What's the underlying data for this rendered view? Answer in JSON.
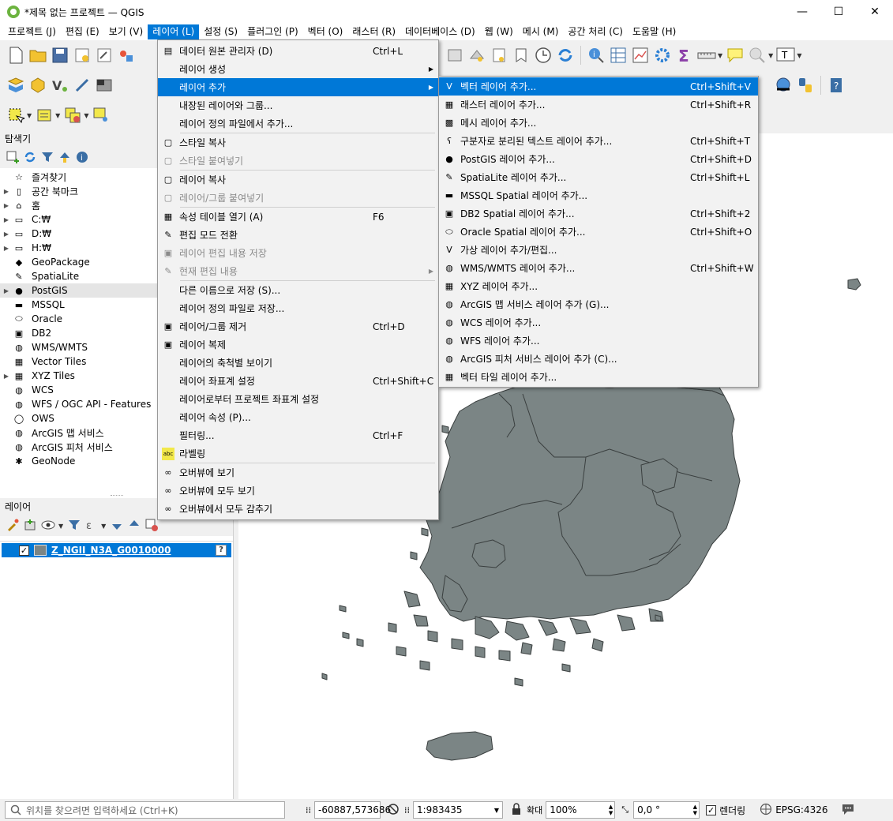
{
  "window": {
    "title": "*제목 없는 프로젝트 — QGIS",
    "minimize": "—",
    "maximize": "☐",
    "close": "✕"
  },
  "menubar": [
    {
      "label": "프로젝트 (J)",
      "active": false
    },
    {
      "label": "편집 (E)",
      "active": false
    },
    {
      "label": "보기 (V)",
      "active": false
    },
    {
      "label": "레이어 (L)",
      "active": true
    },
    {
      "label": "설정 (S)",
      "active": false
    },
    {
      "label": "플러그인 (P)",
      "active": false
    },
    {
      "label": "벡터 (O)",
      "active": false
    },
    {
      "label": "래스터 (R)",
      "active": false
    },
    {
      "label": "데이터베이스 (D)",
      "active": false
    },
    {
      "label": "웹 (W)",
      "active": false
    },
    {
      "label": "메시 (M)",
      "active": false
    },
    {
      "label": "공간 처리 (C)",
      "active": false
    },
    {
      "label": "도움말 (H)",
      "active": false
    }
  ],
  "browser_panel": {
    "title": "탐색기",
    "items": [
      {
        "label": "즐겨찾기",
        "icon": "star-icon",
        "glyph": "☆",
        "expandable": false
      },
      {
        "label": "공간 북마크",
        "icon": "bookmark-icon",
        "glyph": "▯",
        "expandable": true
      },
      {
        "label": "홈",
        "icon": "home-folder-icon",
        "glyph": "⌂",
        "expandable": true
      },
      {
        "label": "C:₩",
        "icon": "drive-icon",
        "glyph": "▭",
        "expandable": true
      },
      {
        "label": "D:₩",
        "icon": "drive-icon",
        "glyph": "▭",
        "expandable": true
      },
      {
        "label": "H:₩",
        "icon": "drive-icon",
        "glyph": "▭",
        "expandable": true
      },
      {
        "label": "GeoPackage",
        "icon": "geopackage-icon",
        "glyph": "◆",
        "expandable": false
      },
      {
        "label": "SpatiaLite",
        "icon": "spatialite-icon",
        "glyph": "✎",
        "expandable": false
      },
      {
        "label": "PostGIS",
        "icon": "postgis-elephant-icon",
        "glyph": "●",
        "expandable": true,
        "selected": true
      },
      {
        "label": "MSSQL",
        "icon": "mssql-icon",
        "glyph": "▬",
        "expandable": false
      },
      {
        "label": "Oracle",
        "icon": "oracle-icon",
        "glyph": "⬭",
        "expandable": false
      },
      {
        "label": "DB2",
        "icon": "db2-icon",
        "glyph": "▣",
        "expandable": false
      },
      {
        "label": "WMS/WMTS",
        "icon": "globe-icon",
        "glyph": "◍",
        "expandable": false
      },
      {
        "label": "Vector Tiles",
        "icon": "grid-icon",
        "glyph": "▦",
        "expandable": false
      },
      {
        "label": "XYZ Tiles",
        "icon": "grid-icon",
        "glyph": "▦",
        "expandable": true
      },
      {
        "label": "WCS",
        "icon": "globe-icon",
        "glyph": "◍",
        "expandable": false
      },
      {
        "label": "WFS / OGC API - Features",
        "icon": "globe-icon",
        "glyph": "◍",
        "expandable": false
      },
      {
        "label": "OWS",
        "icon": "ows-icon",
        "glyph": "◯",
        "expandable": false
      },
      {
        "label": "ArcGIS 맵 서비스",
        "icon": "arcgis-globe-icon",
        "glyph": "◍",
        "expandable": false
      },
      {
        "label": "ArcGIS 피처 서비스",
        "icon": "arcgis-globe-icon",
        "glyph": "◍",
        "expandable": false
      },
      {
        "label": "GeoNode",
        "icon": "geonode-icon",
        "glyph": "✱",
        "expandable": false
      }
    ]
  },
  "layers_panel": {
    "title": "레이어",
    "layer": {
      "name": "Z_NGII_N3A_G0010000",
      "checked": "✓",
      "help": "?"
    }
  },
  "layer_menu": [
    {
      "type": "item",
      "label": "데이터 원본 관리자 (D)",
      "shortcut": "Ctrl+L",
      "icon": "datasource-manager-icon",
      "glyph": "▤"
    },
    {
      "type": "item",
      "label": "레이어 생성",
      "shortcut": "",
      "arrow": true
    },
    {
      "type": "item",
      "label": "레이어 추가",
      "shortcut": "",
      "arrow": true,
      "highlight": true
    },
    {
      "type": "item",
      "label": "내장된 레이어와 그룹...",
      "shortcut": ""
    },
    {
      "type": "item",
      "label": "레이어 정의 파일에서 추가...",
      "shortcut": ""
    },
    {
      "type": "sep"
    },
    {
      "type": "item",
      "label": "스타일 복사",
      "shortcut": "",
      "icon": "copy-style-icon",
      "glyph": "▢"
    },
    {
      "type": "item",
      "label": "스타일 붙여넣기",
      "shortcut": "",
      "icon": "paste-style-icon",
      "glyph": "▢",
      "disabled": true
    },
    {
      "type": "sep"
    },
    {
      "type": "item",
      "label": "레이어 복사",
      "shortcut": "",
      "icon": "copy-layer-icon",
      "glyph": "▢"
    },
    {
      "type": "item",
      "label": "레이어/그룹 붙여넣기",
      "shortcut": "",
      "icon": "paste-layer-icon",
      "glyph": "▢",
      "disabled": true
    },
    {
      "type": "sep"
    },
    {
      "type": "item",
      "label": "속성 테이블 열기 (A)",
      "shortcut": "F6",
      "icon": "attribute-table-icon",
      "glyph": "▦"
    },
    {
      "type": "item",
      "label": "편집 모드 전환",
      "shortcut": "",
      "icon": "pencil-icon",
      "glyph": "✎"
    },
    {
      "type": "item",
      "label": "레이어 편집 내용 저장",
      "shortcut": "",
      "icon": "save-edits-icon",
      "glyph": "▣",
      "disabled": true
    },
    {
      "type": "item",
      "label": "현재 편집 내용",
      "shortcut": "",
      "icon": "current-edits-icon",
      "glyph": "✎",
      "disabled": true,
      "arrow": true
    },
    {
      "type": "sep"
    },
    {
      "type": "item",
      "label": "다른 이름으로 저장 (S)...",
      "shortcut": ""
    },
    {
      "type": "item",
      "label": "레이어 정의 파일로 저장...",
      "shortcut": ""
    },
    {
      "type": "item",
      "label": "레이어/그룹 제거",
      "shortcut": "Ctrl+D",
      "icon": "remove-layer-icon",
      "glyph": "▣"
    },
    {
      "type": "item",
      "label": "레이어 복제",
      "shortcut": "",
      "icon": "duplicate-layer-icon",
      "glyph": "▣"
    },
    {
      "type": "item",
      "label": "레이어의 축척별 보이기",
      "shortcut": ""
    },
    {
      "type": "item",
      "label": "레이어 좌표계 설정",
      "shortcut": "Ctrl+Shift+C"
    },
    {
      "type": "item",
      "label": "레이어로부터 프로젝트 좌표계 설정",
      "shortcut": ""
    },
    {
      "type": "item",
      "label": "레이어 속성 (P)...",
      "shortcut": ""
    },
    {
      "type": "item",
      "label": "필터링...",
      "shortcut": "Ctrl+F"
    },
    {
      "type": "item",
      "label": "라벨링",
      "shortcut": "",
      "icon": "labeling-icon",
      "glyph": "abc"
    },
    {
      "type": "sep"
    },
    {
      "type": "item",
      "label": "오버뷰에 보기",
      "shortcut": "",
      "icon": "overview-add-icon",
      "glyph": "∞"
    },
    {
      "type": "item",
      "label": "오버뷰에 모두 보기",
      "shortcut": "",
      "icon": "overview-all-icon",
      "glyph": "∞"
    },
    {
      "type": "item",
      "label": "오버뷰에서 모두 감추기",
      "shortcut": "",
      "icon": "overview-hide-icon",
      "glyph": "∞"
    }
  ],
  "add_layer_submenu": [
    {
      "label": "벡터 레이어 추가...",
      "shortcut": "Ctrl+Shift+V",
      "icon": "vector-layer-icon",
      "glyph": "V",
      "highlight": true
    },
    {
      "label": "래스터 레이어 추가...",
      "shortcut": "Ctrl+Shift+R",
      "icon": "raster-layer-icon",
      "glyph": "▦"
    },
    {
      "label": "메시 레이어 추가...",
      "shortcut": "",
      "icon": "mesh-layer-icon",
      "glyph": "▩"
    },
    {
      "label": "구분자로 분리된 텍스트 레이어 추가...",
      "shortcut": "Ctrl+Shift+T",
      "icon": "delimited-text-icon",
      "glyph": "ʕ"
    },
    {
      "label": "PostGIS 레이어 추가...",
      "shortcut": "Ctrl+Shift+D",
      "icon": "postgis-elephant-icon",
      "glyph": "●"
    },
    {
      "label": "SpatiaLite 레이어 추가...",
      "shortcut": "Ctrl+Shift+L",
      "icon": "spatialite-icon",
      "glyph": "✎"
    },
    {
      "label": "MSSQL Spatial 레이어 추가...",
      "shortcut": "",
      "icon": "mssql-icon",
      "glyph": "▬"
    },
    {
      "label": "DB2 Spatial 레이어 추가...",
      "shortcut": "Ctrl+Shift+2",
      "icon": "db2-icon",
      "glyph": "▣"
    },
    {
      "label": "Oracle Spatial 레이어 추가...",
      "shortcut": "Ctrl+Shift+O",
      "icon": "oracle-icon",
      "glyph": "⬭"
    },
    {
      "label": "가상 레이어 추가/편집...",
      "shortcut": "",
      "icon": "virtual-layer-icon",
      "glyph": "V"
    },
    {
      "label": "WMS/WMTS 레이어 추가...",
      "shortcut": "Ctrl+Shift+W",
      "icon": "wms-globe-icon",
      "glyph": "◍"
    },
    {
      "label": "XYZ 레이어 추가...",
      "shortcut": "",
      "icon": "xyz-grid-icon",
      "glyph": "▦"
    },
    {
      "label": "ArcGIS 맵 서비스 레이어 추가 (G)...",
      "shortcut": "",
      "icon": "arcgis-globe-icon",
      "glyph": "◍"
    },
    {
      "label": "WCS 레이어 추가...",
      "shortcut": "",
      "icon": "wcs-globe-icon",
      "glyph": "◍"
    },
    {
      "label": "WFS 레이어 추가...",
      "shortcut": "",
      "icon": "wfs-globe-icon",
      "glyph": "◍"
    },
    {
      "label": "ArcGIS 피처 서비스 레이어 추가 (C)...",
      "shortcut": "",
      "icon": "arcgis-globe-icon",
      "glyph": "◍"
    },
    {
      "label": "벡터 타일 레이어 추가...",
      "shortcut": "",
      "icon": "vector-tile-icon",
      "glyph": "▦"
    }
  ],
  "statusbar": {
    "search_placeholder": "위치를 찾으려면 입력하세요 (Ctrl+K)",
    "coordinate": "-60887,573686",
    "scale": "1:983435",
    "magnifier_label": "확대",
    "magnifier": "100%",
    "rotation": "0,0 °",
    "render_label": "렌더링",
    "render_checked": "✓",
    "crs": "EPSG:4326"
  },
  "colors": {
    "accent": "#0078d7",
    "land": "#7b8585",
    "map_bg": "#ffffff"
  }
}
